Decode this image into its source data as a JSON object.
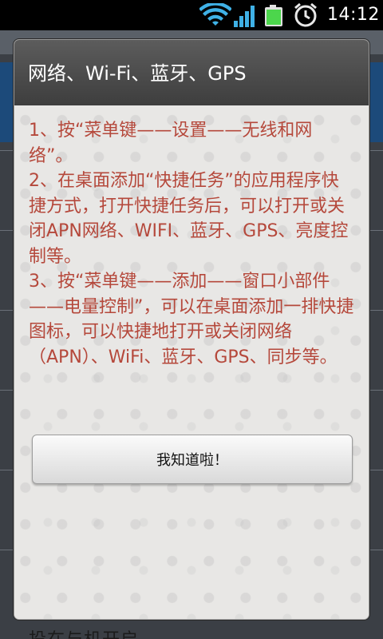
{
  "status_bar": {
    "time": "14:12",
    "icons": [
      "wifi-icon",
      "signal-icon",
      "battery-icon",
      "alarm-icon"
    ]
  },
  "background_app": {
    "bottom_text": "投在与机开启"
  },
  "dialog": {
    "title": "网络、Wi-Fi、蓝牙、GPS",
    "paragraphs": [
      "1、按“菜单键——设置——无线和网络”。",
      "2、在桌面添加“快捷任务”的应用程序快捷方式，打开快捷任务后，可以打开或关闭APN网络、WIFI、蓝牙、GPS、亮度控制等。",
      "3、按“菜单键——添加——窗口小部件——电量控制”，可以在桌面添加一排快捷图标，可以快捷地打开或关闭网络（APN）、WiFi、蓝牙、GPS、同步等。"
    ],
    "button_label": "我知道啦！"
  },
  "colors": {
    "dialog_text": "#b5483b",
    "header": "#4a4a4a",
    "status_bar": "#000000",
    "wifi": "#3fb1e6",
    "battery": "#4cd64c"
  }
}
